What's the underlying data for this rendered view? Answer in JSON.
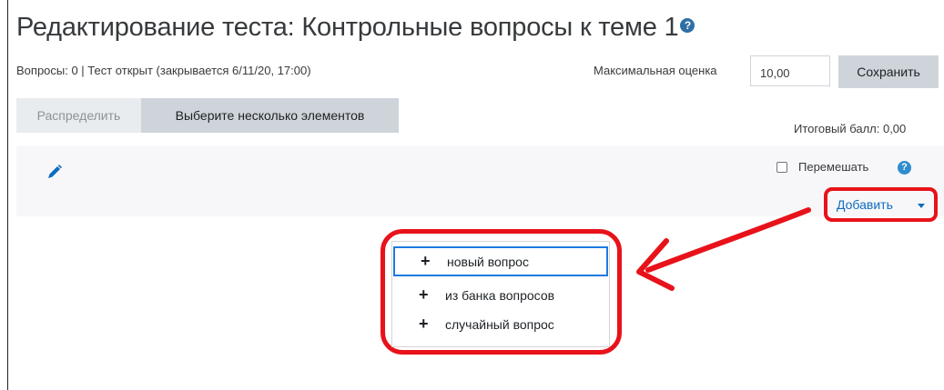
{
  "header": {
    "title": "Редактирование теста: Контрольные вопросы к теме 1",
    "help_icon": "?"
  },
  "status": {
    "text": "Вопросы: 0 | Тест открыт (закрывается 6/11/20, 17:00)"
  },
  "grade": {
    "max_label": "Максимальная оценка",
    "max_value": "10,00",
    "save_label": "Сохранить",
    "total_label": "Итоговый балл: 0,00"
  },
  "toolbar": {
    "repaginate_label": "Распределить",
    "select_multiple_label": "Выберите несколько элементов"
  },
  "section": {
    "edit_icon": "pencil-icon",
    "shuffle_label": "Перемешать",
    "shuffle_checked": false,
    "help_icon": "?",
    "add_label": "Добавить"
  },
  "add_menu": {
    "items": [
      {
        "label": "новый вопрос",
        "icon": "+"
      },
      {
        "label": "из банка вопросов",
        "icon": "+"
      },
      {
        "label": "случайный вопрос",
        "icon": "+"
      }
    ]
  },
  "colors": {
    "annotation_red": "#e8121a",
    "link_blue": "#0f6cbf",
    "focus_blue": "#1d7ae2"
  }
}
